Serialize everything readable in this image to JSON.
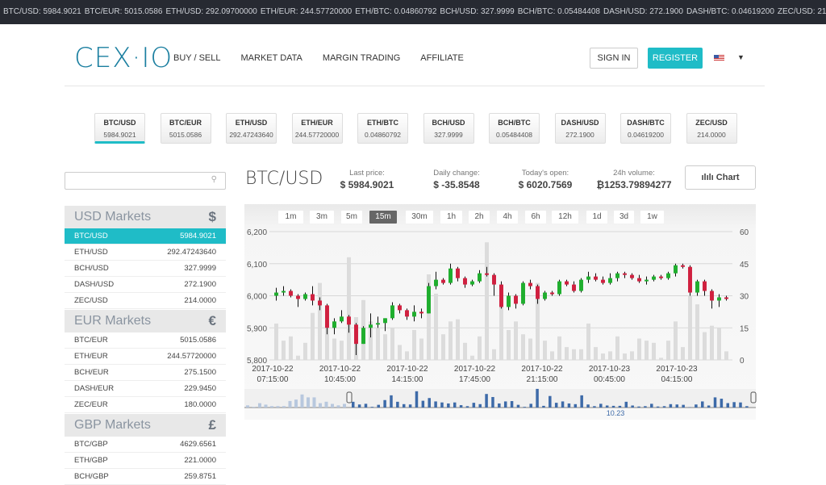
{
  "ticker": [
    "BTC/USD: 5984.9021",
    "BTC/EUR: 5015.0586",
    "ETH/USD: 292.09700000",
    "ETH/EUR: 244.57720000",
    "ETH/BTC: 0.04860792",
    "BCH/USD: 327.9999",
    "BCH/BTC: 0.05484408",
    "DASH/USD: 272.1900",
    "DASH/BTC: 0.04619200",
    "ZEC/USD: 214.0000"
  ],
  "header": {
    "logo": "CEX·IO",
    "nav": [
      "BUY / SELL",
      "MARKET DATA",
      "MARGIN TRADING",
      "AFFILIATE"
    ],
    "sign_in": "SIGN IN",
    "register": "REGISTER",
    "language_flag": "us-flag"
  },
  "pairs": [
    {
      "name": "BTC/USD",
      "value": "5984.9021",
      "active": true
    },
    {
      "name": "BTC/EUR",
      "value": "5015.0586"
    },
    {
      "name": "ETH/USD",
      "value": "292.47243640"
    },
    {
      "name": "ETH/EUR",
      "value": "244.57720000"
    },
    {
      "name": "ETH/BTC",
      "value": "0.04860792"
    },
    {
      "name": "BCH/USD",
      "value": "327.9999"
    },
    {
      "name": "BCH/BTC",
      "value": "0.05484408"
    },
    {
      "name": "DASH/USD",
      "value": "272.1900"
    },
    {
      "name": "DASH/BTC",
      "value": "0.04619200"
    },
    {
      "name": "ZEC/USD",
      "value": "214.0000"
    }
  ],
  "search": {
    "placeholder": "",
    "icon": "search-icon"
  },
  "markets": [
    {
      "title": "USD Markets",
      "symbol": "$",
      "rows": [
        [
          "BTC/USD",
          "5984.9021"
        ],
        [
          "ETH/USD",
          "292.47243640"
        ],
        [
          "BCH/USD",
          "327.9999"
        ],
        [
          "DASH/USD",
          "272.1900"
        ],
        [
          "ZEC/USD",
          "214.0000"
        ]
      ]
    },
    {
      "title": "EUR Markets",
      "symbol": "€",
      "rows": [
        [
          "BTC/EUR",
          "5015.0586"
        ],
        [
          "ETH/EUR",
          "244.57720000"
        ],
        [
          "BCH/EUR",
          "275.1500"
        ],
        [
          "DASH/EUR",
          "229.9450"
        ],
        [
          "ZEC/EUR",
          "180.0000"
        ]
      ]
    },
    {
      "title": "GBP Markets",
      "symbol": "£",
      "rows": [
        [
          "BTC/GBP",
          "4629.6561"
        ],
        [
          "ETH/GBP",
          "221.0000"
        ],
        [
          "BCH/GBP",
          "259.8751"
        ]
      ]
    }
  ],
  "main": {
    "pair": "BTC/USD",
    "stats": [
      {
        "label": "Last price:",
        "value": "$ 5984.9021"
      },
      {
        "label": "Daily change:",
        "value": "$ -35.8548"
      },
      {
        "label": "Today's open:",
        "value": "$ 6020.7569"
      },
      {
        "label": "24h volume:",
        "value": "₿1253.79894277"
      }
    ],
    "chart_button": "Chart"
  },
  "timeframes": [
    "1m",
    "3m",
    "5m",
    "15m",
    "30m",
    "1h",
    "2h",
    "4h",
    "6h",
    "12h",
    "1d",
    "3d",
    "1w"
  ],
  "active_timeframe": "15m",
  "colors": {
    "accent": "#1fbcc7",
    "up": "#1fae2e",
    "down": "#d0203f",
    "volume": "#dcdcdc",
    "navigator": "#3d6aa8"
  },
  "chart_data": {
    "type": "candlestick",
    "y_left": {
      "ticks": [
        "6,200",
        "6,100",
        "6,000",
        "5,900",
        "5,800"
      ],
      "range": [
        5800,
        6200
      ]
    },
    "y_right": {
      "ticks": [
        "60",
        "45",
        "30",
        "15",
        "0"
      ],
      "range": [
        0,
        60
      ]
    },
    "x_ticks": [
      [
        "2017-10-22",
        "07:15:00"
      ],
      [
        "2017-10-22",
        "10:45:00"
      ],
      [
        "2017-10-22",
        "14:15:00"
      ],
      [
        "2017-10-22",
        "17:45:00"
      ],
      [
        "2017-10-22",
        "21:15:00"
      ],
      [
        "2017-10-23",
        "00:45:00"
      ],
      [
        "2017-10-23",
        "04:15:00"
      ]
    ],
    "navigator_label": "10.23",
    "candles_ohlcv": [
      [
        6000,
        6025,
        5985,
        6010,
        17
      ],
      [
        6010,
        6030,
        6000,
        6015,
        9
      ],
      [
        6015,
        6020,
        5995,
        6000,
        11
      ],
      [
        6000,
        6005,
        5965,
        5990,
        2
      ],
      [
        5990,
        6010,
        5985,
        6005,
        8
      ],
      [
        6005,
        6030,
        5970,
        5985,
        22
      ],
      [
        5985,
        5995,
        5955,
        5970,
        36
      ],
      [
        5970,
        5975,
        5880,
        5900,
        17
      ],
      [
        5900,
        5930,
        5880,
        5920,
        10
      ],
      [
        5920,
        5955,
        5915,
        5935,
        9
      ],
      [
        5935,
        5940,
        5885,
        5910,
        48
      ],
      [
        5910,
        5915,
        5815,
        5850,
        20
      ],
      [
        5850,
        5905,
        5850,
        5900,
        28
      ],
      [
        5900,
        5945,
        5870,
        5910,
        18
      ],
      [
        5910,
        5935,
        5900,
        5915,
        15
      ],
      [
        5915,
        5930,
        5890,
        5930,
        12
      ],
      [
        5930,
        5980,
        5925,
        5970,
        15
      ],
      [
        5970,
        5975,
        5945,
        5955,
        7
      ],
      [
        5955,
        5960,
        5925,
        5935,
        4
      ],
      [
        5935,
        5970,
        5920,
        5950,
        14
      ],
      [
        5950,
        5960,
        5930,
        5945,
        10
      ],
      [
        5945,
        6040,
        5945,
        6030,
        40
      ],
      [
        6030,
        6075,
        6020,
        6050,
        31
      ],
      [
        6050,
        6055,
        6035,
        6040,
        12
      ],
      [
        6040,
        6100,
        6035,
        6085,
        18
      ],
      [
        6085,
        6090,
        6045,
        6055,
        19
      ],
      [
        6055,
        6060,
        6025,
        6035,
        8
      ],
      [
        6035,
        6050,
        6030,
        6045,
        2
      ],
      [
        6045,
        6080,
        6040,
        6070,
        11
      ],
      [
        6070,
        6090,
        6060,
        6065,
        55
      ],
      [
        6065,
        6070,
        6000,
        6035,
        5
      ],
      [
        6035,
        6045,
        5960,
        5965,
        34
      ],
      [
        5965,
        6010,
        5955,
        6000,
        14
      ],
      [
        6000,
        6005,
        5960,
        5975,
        18
      ],
      [
        5975,
        6045,
        5970,
        6040,
        12
      ],
      [
        6040,
        6050,
        6020,
        6030,
        10
      ],
      [
        6030,
        6035,
        5975,
        5990,
        36
      ],
      [
        5990,
        6015,
        5985,
        6010,
        9
      ],
      [
        6010,
        6015,
        6000,
        6005,
        4
      ],
      [
        6005,
        6050,
        6000,
        6045,
        11
      ],
      [
        6045,
        6050,
        6030,
        6035,
        6
      ],
      [
        6035,
        6045,
        6010,
        6015,
        5
      ],
      [
        6015,
        6055,
        6010,
        6050,
        5
      ],
      [
        6050,
        6075,
        6040,
        6060,
        17
      ],
      [
        6060,
        6070,
        6045,
        6050,
        6
      ],
      [
        6050,
        6060,
        6035,
        6040,
        3
      ],
      [
        6040,
        6070,
        6035,
        6055,
        4
      ],
      [
        6055,
        6075,
        6045,
        6070,
        11
      ],
      [
        6070,
        6075,
        6055,
        6065,
        3
      ],
      [
        6065,
        6070,
        6050,
        6055,
        4
      ],
      [
        6055,
        6065,
        6040,
        6045,
        10
      ],
      [
        6045,
        6060,
        6035,
        6050,
        9
      ],
      [
        6050,
        6065,
        6045,
        6060,
        8
      ],
      [
        6060,
        6065,
        6050,
        6055,
        1
      ],
      [
        6055,
        6075,
        6050,
        6070,
        9
      ],
      [
        6070,
        6100,
        6060,
        6095,
        18
      ],
      [
        6095,
        6100,
        6085,
        6090,
        6
      ],
      [
        6090,
        6095,
        6000,
        6010,
        30
      ],
      [
        6010,
        6050,
        6000,
        6045,
        26
      ],
      [
        6045,
        6050,
        6000,
        6015,
        13
      ],
      [
        6015,
        6020,
        5960,
        5985,
        16
      ],
      [
        5985,
        6005,
        5965,
        5995,
        15
      ],
      [
        5995,
        6000,
        5985,
        5990,
        4
      ]
    ]
  }
}
